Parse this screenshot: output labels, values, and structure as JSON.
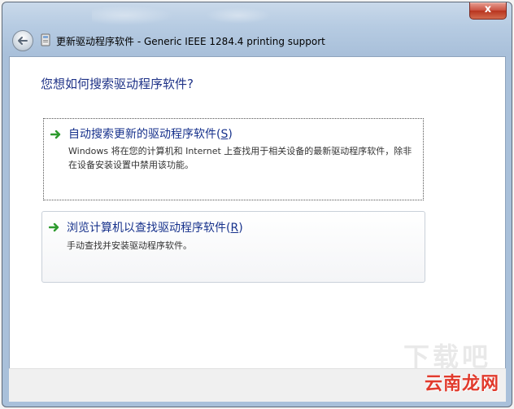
{
  "window": {
    "title": "更新驱动程序软件 - Generic IEEE 1284.4 printing support",
    "close_label": "x"
  },
  "page": {
    "question": "您想如何搜索驱动程序软件?"
  },
  "options": [
    {
      "title": "自动搜索更新的驱动程序软件(",
      "hotkey": "S",
      "title_end": ")",
      "description": "Windows 将在您的计算机和 Internet 上查找用于相关设备的最新驱动程序软件，除非在设备安装设置中禁用该功能。"
    },
    {
      "title": "浏览计算机以查找驱动程序软件(",
      "hotkey": "R",
      "title_end": ")",
      "description": "手动查找并安装驱动程序软件。"
    }
  ],
  "watermark": {
    "text": "云南龙网",
    "ghost": "下载吧"
  },
  "colors": {
    "accent_text": "#17328c",
    "arrow_green": "#2e9b2e",
    "watermark_red": "#e13b2d"
  },
  "icons": {
    "back": "back-arrow-icon",
    "title": "device-icon",
    "option": "green-arrow-icon"
  }
}
